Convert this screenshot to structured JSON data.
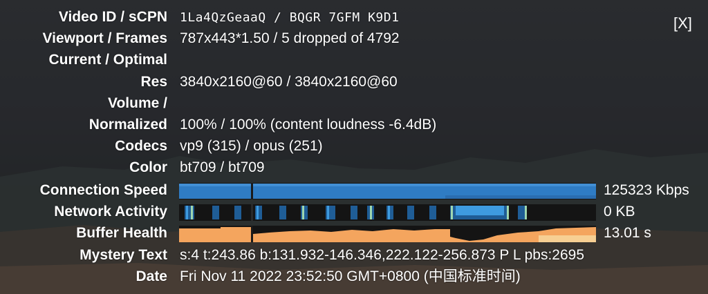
{
  "close_label": "[X]",
  "rows": {
    "video_id": {
      "label": "Video ID / sCPN",
      "value": "1La4QzGeaaQ  /  BQGR 7GFM K9D1"
    },
    "viewport": {
      "label": "Viewport / Frames",
      "value": "787x443*1.50 / 5 dropped of 4792"
    },
    "current_optimal": {
      "label": "Current / Optimal"
    },
    "res": {
      "label": "Res",
      "value": "3840x2160@60 / 3840x2160@60"
    },
    "volume": {
      "label": "Volume /"
    },
    "normalized": {
      "label": "Normalized",
      "value": "100% / 100% (content loudness -6.4dB)"
    },
    "codecs": {
      "label": "Codecs",
      "value": "vp9 (315) / opus (251)"
    },
    "color": {
      "label": "Color",
      "value": "bt709 / bt709"
    },
    "connection_speed": {
      "label": "Connection Speed",
      "value": "125323 Kbps"
    },
    "network_activity": {
      "label": "Network Activity",
      "value": "0 KB"
    },
    "buffer_health": {
      "label": "Buffer Health",
      "value": "13.01 s"
    },
    "mystery_text": {
      "label": "Mystery Text",
      "value": "s:4 t:243.86 b:131.932-146.346,222.122-256.873 P L pbs:2695"
    },
    "date": {
      "label": "Date",
      "value": "Fri Nov 11 2022 23:52:50 GMT+0800 (中国标准时间)"
    }
  },
  "colors": {
    "connection_bar": "#2f7cc4",
    "network_bar": "#1f5d96",
    "network_highlight": "#9fd7b0",
    "buffer_bar": "#f4a55e",
    "graph_bg": "#141414"
  }
}
